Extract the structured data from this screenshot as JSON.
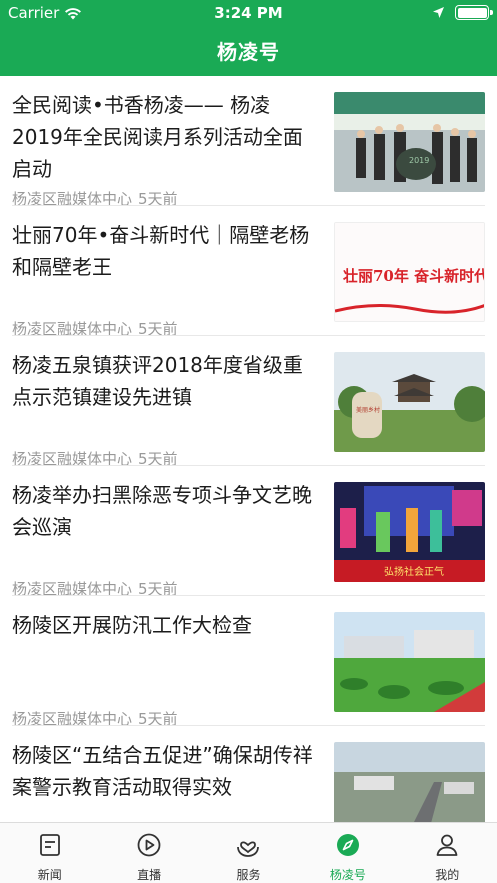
{
  "status_bar": {
    "carrier": "Carrier",
    "time": "3:24 PM"
  },
  "header": {
    "title": "杨凌号"
  },
  "articles": [
    {
      "title": "全民阅读•书香杨凌—— 杨凌2019年全民阅读月系列活动全面启动",
      "source": "杨凌区融媒体中心",
      "time": "5天前",
      "thumb_text": "2019"
    },
    {
      "title": "壮丽70年•奋斗新时代｜隔壁老杨和隔壁老王",
      "source": "杨凌区融媒体中心",
      "time": "5天前",
      "thumb_text": "壮丽70年 奋斗新时代"
    },
    {
      "title": "杨凌五泉镇获评2018年度省级重点示范镇建设先进镇",
      "source": "杨凌区融媒体中心",
      "time": "5天前",
      "thumb_text": "美丽乡村"
    },
    {
      "title": "杨凌举办扫黑除恶专项斗争文艺晚会巡演",
      "source": "杨凌区融媒体中心",
      "time": "5天前",
      "thumb_text": "弘扬社会正气"
    },
    {
      "title": "杨陵区开展防汛工作大检查",
      "source": "杨凌区融媒体中心",
      "time": "5天前",
      "thumb_text": ""
    },
    {
      "title": "杨陵区“五结合五促进”确保胡传祥案警示教育活动取得实效",
      "source": "",
      "time": "",
      "thumb_text": ""
    }
  ],
  "tabs": [
    {
      "label": "新闻",
      "icon": "news-icon",
      "active": false
    },
    {
      "label": "直播",
      "icon": "play-icon",
      "active": false
    },
    {
      "label": "服务",
      "icon": "service-icon",
      "active": false
    },
    {
      "label": "杨凌号",
      "icon": "compass-icon",
      "active": true
    },
    {
      "label": "我的",
      "icon": "user-icon",
      "active": false
    }
  ],
  "colors": {
    "brand": "#1aaa55",
    "meta_text": "#999999",
    "divider": "#e8e8e8"
  }
}
